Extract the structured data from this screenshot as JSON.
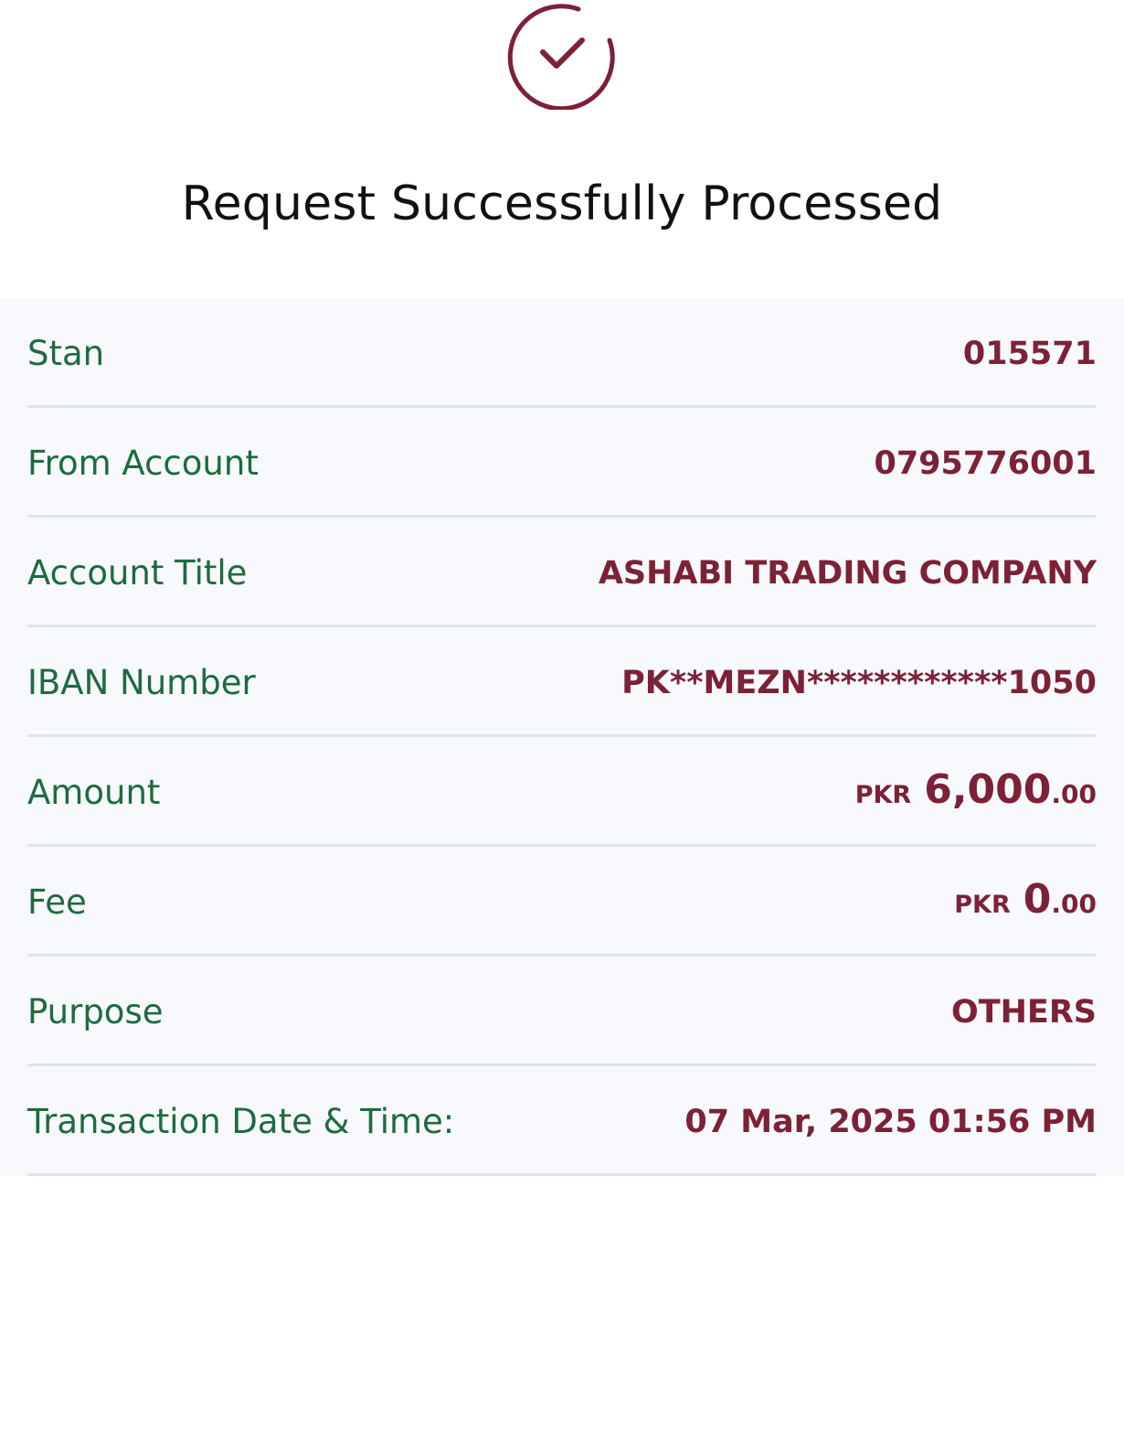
{
  "header": {
    "title": "Request Successfully Processed",
    "icon": "success-check-icon",
    "accent_color": "#7c2136"
  },
  "colors": {
    "label": "#1d6b3e",
    "value": "#7c2136",
    "divider": "#dde5ec",
    "panel_bg": "#f8f9fc"
  },
  "details": {
    "stan": {
      "label": "Stan",
      "value": "015571"
    },
    "from_account": {
      "label": "From Account",
      "value": "0795776001"
    },
    "account_title": {
      "label": "Account Title",
      "value": "ASHABI TRADING COMPANY"
    },
    "iban": {
      "label": "IBAN Number",
      "value": "PK**MEZN************1050"
    },
    "amount": {
      "label": "Amount",
      "currency": "PKR",
      "integer": "6,000",
      "decimal": ".00"
    },
    "fee": {
      "label": "Fee",
      "currency": "PKR",
      "integer": "0",
      "decimal": ".00"
    },
    "purpose": {
      "label": "Purpose",
      "value": "OTHERS"
    },
    "datetime": {
      "label": "Transaction Date & Time:",
      "value": "07 Mar, 2025 01:56 PM"
    }
  }
}
